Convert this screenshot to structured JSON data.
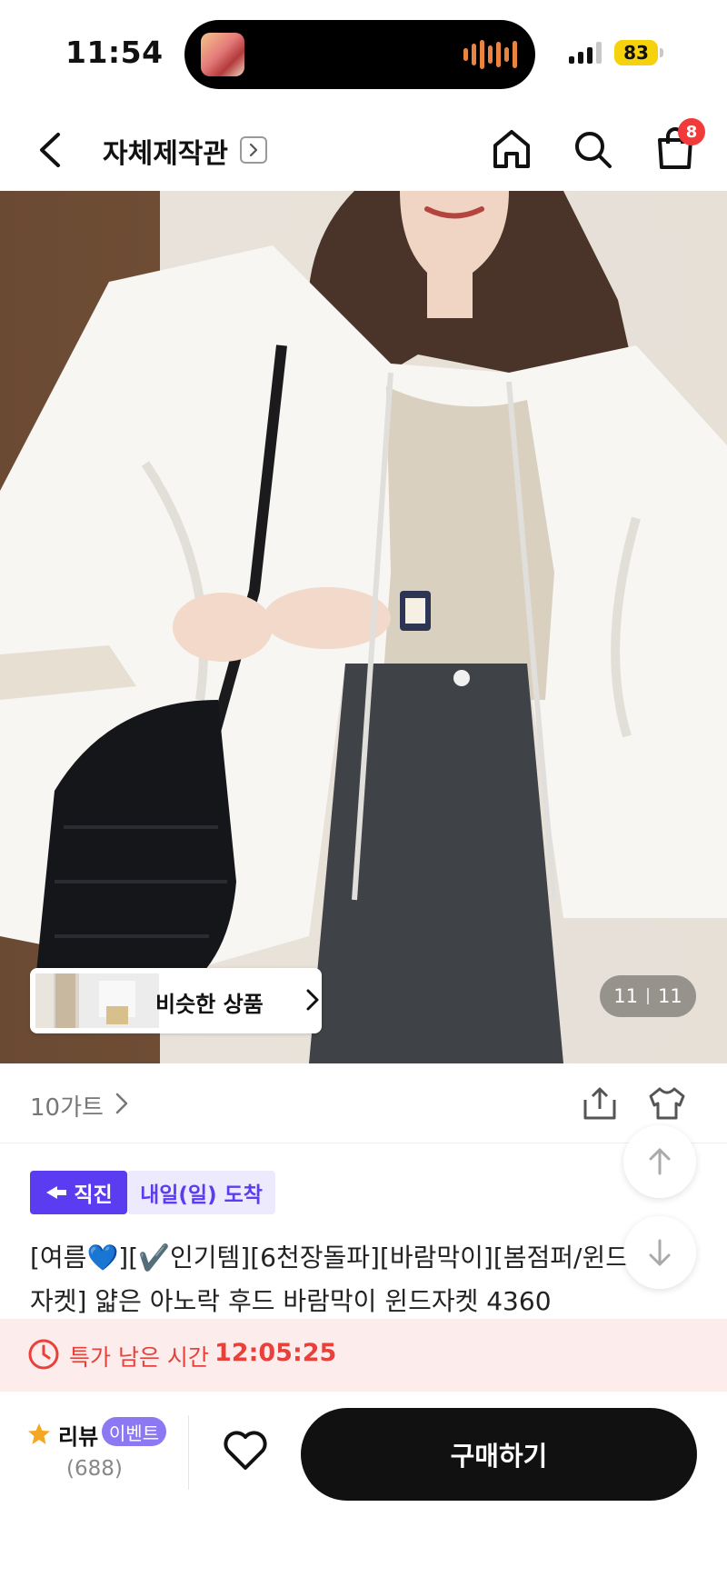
{
  "status_bar": {
    "time": "11:54",
    "battery": "83"
  },
  "header": {
    "shop_name": "자체제작관",
    "cart_count": "8"
  },
  "gallery": {
    "similar_label": "비슷한 상품",
    "current_index": "11",
    "total": "11"
  },
  "brand": {
    "name": "10가트"
  },
  "badges": {
    "direct": "직진",
    "arrival": "내일(일) 도착"
  },
  "product": {
    "title": "[여름💙][✔️인기템][6천장돌파][바람막이][봄점퍼/윈드자켓] 얇은 아노락 후드 바람막이 윈드자켓 4360"
  },
  "deal": {
    "label": "특가 남은 시간",
    "time": "12:05:25"
  },
  "bottom": {
    "review_label": "리뷰",
    "event_label": "이벤트",
    "review_count": "(688)",
    "buy_label": "구매하기"
  },
  "colors": {
    "accent": "#5b3cf0",
    "deal": "#e8413c",
    "badge": "#f23a3a"
  }
}
